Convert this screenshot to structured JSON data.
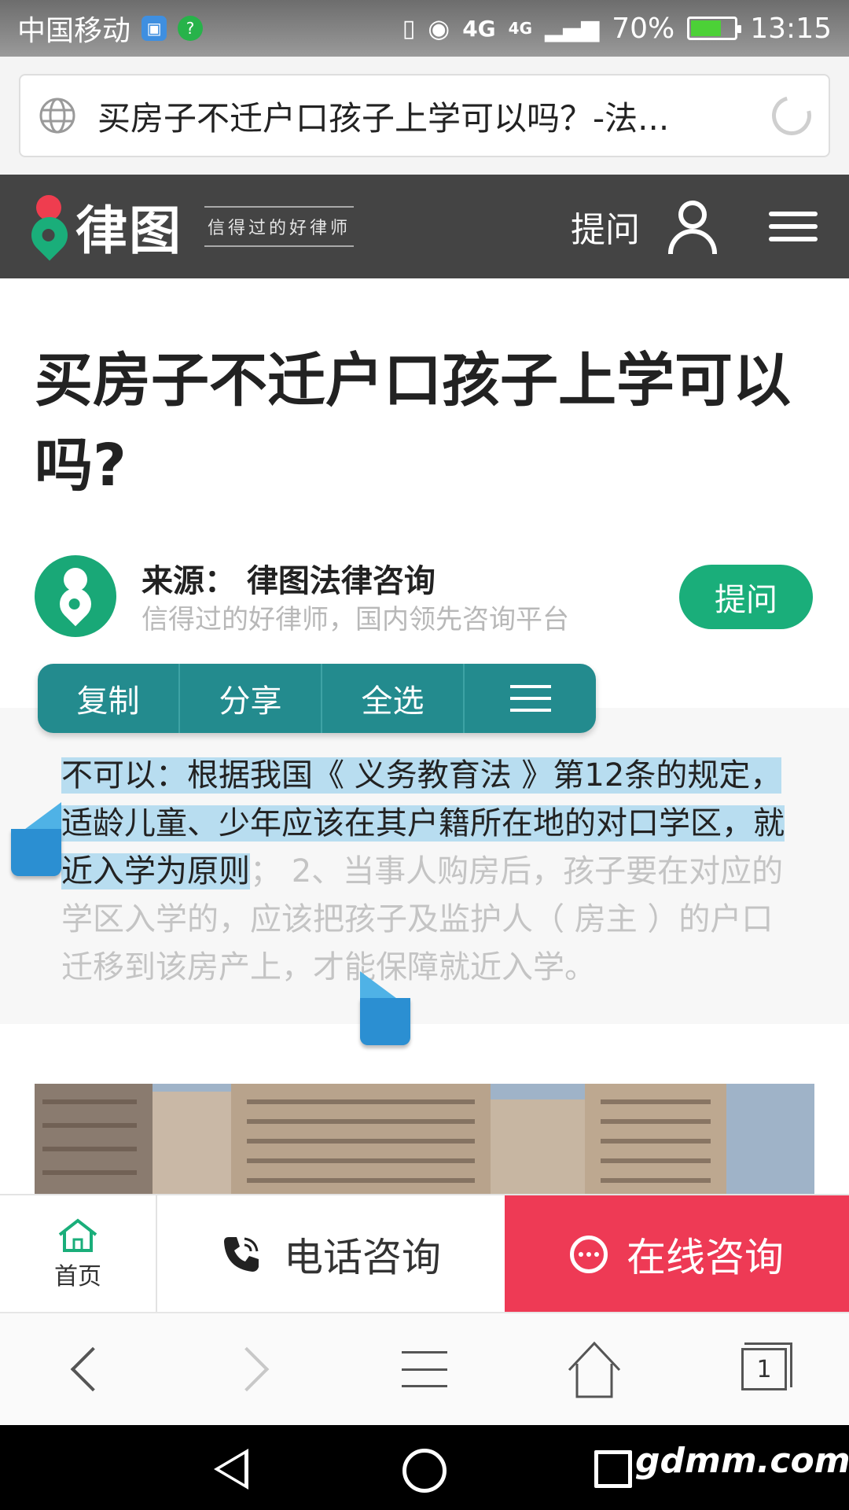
{
  "status_bar": {
    "carrier": "中国移动",
    "network_1": "4G",
    "network_2": "4G",
    "battery_percent": "70%",
    "battery_level": 0.7,
    "time": "13:15"
  },
  "address_bar": {
    "title": "买房子不迁户口孩子上学可以吗？-法..."
  },
  "site_header": {
    "logo_text": "律图",
    "slogan": "信得过的好律师",
    "ask_label": "提问",
    "colors": {
      "brand_green": "#1aae7a",
      "brand_red": "#ef3d4f",
      "header_bg": "#444444"
    }
  },
  "article": {
    "title": "买房子不迁户口孩子上学可以吗?",
    "source_label": "来源：  律图法律咨询",
    "source_desc": "信得过的好律师，国内领先咨询平台",
    "ask_button": "提问",
    "answer_selected": "不可以：根据我国《 义务教育法 》第12条的规定，适龄儿童、少年应该在其户籍所在地的对口学区，就近入学为原则",
    "answer_rest": "； 2、当事人购房后，孩子要在对应的学区入学的，应该把孩子及监护人（ 房主 ）的户口迁移到该房产上，才能保障就近入学。"
  },
  "context_menu": {
    "items": [
      "复制",
      "分享",
      "全选"
    ],
    "more_icon": "menu-icon"
  },
  "action_bar": {
    "home_label": "首页",
    "phone_label": "电话咨询",
    "online_label": "在线咨询",
    "online_color": "#ee3a55"
  },
  "browser_nav": {
    "tab_count": "1"
  },
  "system_nav": {
    "watermark": "gdmm.com"
  }
}
